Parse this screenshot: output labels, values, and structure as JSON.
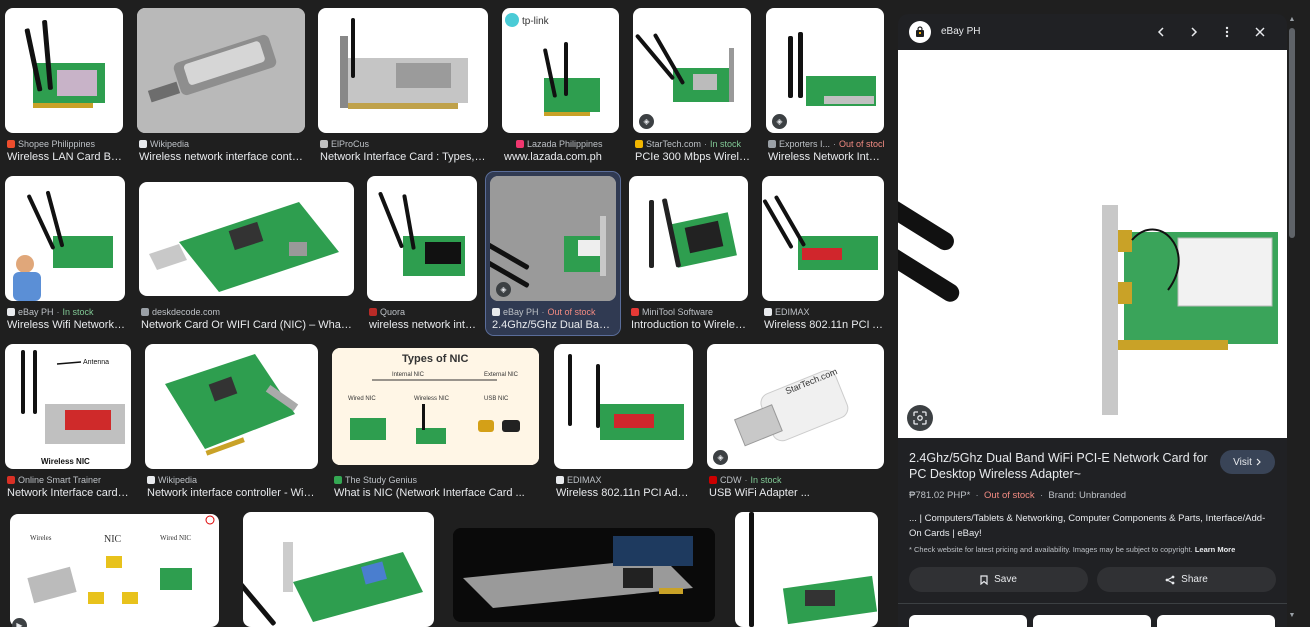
{
  "results": [
    {
      "source": "Shopee Philippines",
      "title": "Wireless LAN Card BT ...",
      "fav": "#ee4d2d"
    },
    {
      "source": "Wikipedia",
      "title": "Wireless network interface controll...",
      "fav": "#e8eaed"
    },
    {
      "source": "ElProCus",
      "title": "Network Interface Card : Types, Wo...",
      "fav": "#c0c0c0"
    },
    {
      "source": "Lazada Philippines",
      "title": "www.lazada.com.ph",
      "fav": "#f0376f"
    },
    {
      "source": "StarTech.com",
      "stock": "In stock",
      "title": "PCIe 300 Mbps Wireles...",
      "fav": "#f2b600"
    },
    {
      "source": "Exporters I...",
      "stock": "Out of stock",
      "title": "Wireless Network Interf...",
      "fav": "#9aa0a6"
    },
    {
      "source": "eBay PH",
      "stock": "In stock",
      "title": "Wireless Wifi Network C...",
      "fav": "#e8eaed"
    },
    {
      "source": "deskdecode.com",
      "title": "Network Card Or WIFI Card (NIC) – What ...",
      "fav": "#9aa0a6"
    },
    {
      "source": "Quora",
      "title": "wireless network inter...",
      "fav": "#b92b27"
    },
    {
      "source": "eBay PH",
      "stock": "Out of stock",
      "title": "2.4Ghz/5Ghz Dual Band ...",
      "fav": "#e8eaed"
    },
    {
      "source": "MiniTool Software",
      "title": "Introduction to Wireless...",
      "fav": "#e53935"
    },
    {
      "source": "EDIMAX",
      "title": "Wireless 802.11n PCI Ad...",
      "fav": "#e8eaed"
    },
    {
      "source": "Online Smart Trainer",
      "title": "Network Interface card | ...",
      "fav": "#d93025"
    },
    {
      "source": "Wikipedia",
      "title": "Network interface controller - Wikip...",
      "fav": "#e8eaed"
    },
    {
      "source": "The Study Genius",
      "title": "What is NIC (Network Interface Card ...",
      "fav": "#34a853"
    },
    {
      "source": "EDIMAX",
      "title": "Wireless 802.11n PCI Adapter",
      "fav": "#e8eaed"
    },
    {
      "source": "CDW",
      "stock": "In stock",
      "title": "USB WiFi Adapter ...",
      "fav": "#cc0000"
    }
  ],
  "thumb_text": {
    "tplink": "tp-link",
    "antenna": "Antenna",
    "wireless_nic": "Wireless NIC",
    "types_title": "Types of NIC",
    "internal": "Internal NIC",
    "external": "External NIC",
    "wired": "Wired NIC",
    "wireless": "Wireless NIC",
    "usb": "USB NIC",
    "nic": "NIC",
    "wireless_lbl": "Wireles",
    "wired_lbl": "Wired NIC",
    "startech": "StarTech.com"
  },
  "panel": {
    "site": "eBay PH",
    "title": "2.4Ghz/5Ghz Dual Band WiFi PCI-E Network Card for PC Desktop Wireless Adapter~",
    "visit": "Visit",
    "price": "₱781.02 PHP*",
    "stock": "Out of stock",
    "brand": "Brand: Unbranded",
    "description": "... | Computers/Tablets & Networking, Computer Components & Parts, Interface/Add-On Cards | eBay!",
    "note": "* Check website for latest pricing and availability. Images may be subject to copyright.",
    "learn_more": "Learn More",
    "save": "Save",
    "share": "Share"
  },
  "colors": {
    "accent": "#394457",
    "in_stock": "#81c995",
    "out_of_stock": "#f28b82",
    "pcb_green": "#2e9e4f"
  }
}
